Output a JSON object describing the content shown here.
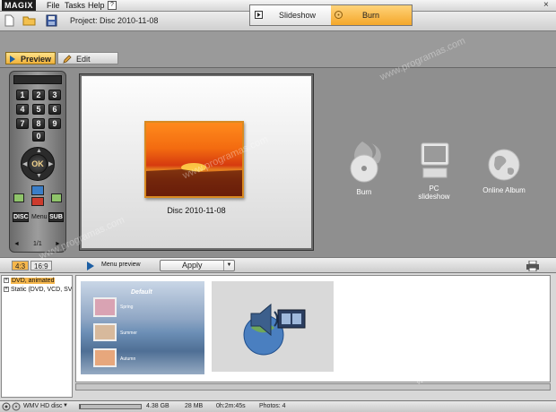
{
  "app": {
    "logo": "MAGIX",
    "menu": [
      "File",
      "Tasks",
      "Help"
    ],
    "close": "×"
  },
  "toolbar": {
    "project_label": "Project: Disc 2010-11-08"
  },
  "modes": {
    "slideshow": "Slideshow",
    "burn": "Burn"
  },
  "view_tabs": {
    "preview": "Preview",
    "edit": "Edit"
  },
  "remote": {
    "keys": [
      "1",
      "2",
      "3",
      "4",
      "5",
      "6",
      "7",
      "8",
      "9",
      "0"
    ],
    "ok": "OK",
    "disc": "DISC",
    "menu": "Menu",
    "sub": "SUB",
    "page": "1/1"
  },
  "preview": {
    "title": "Disc 2010-11-08"
  },
  "options": {
    "burn": "Burn",
    "pc_slideshow_line1": "PC",
    "pc_slideshow_line2": "slideshow",
    "online_album": "Online Album"
  },
  "lower_bar": {
    "ratio_43": "4:3",
    "ratio_169": "16:9",
    "menu_preview": "Menu preview",
    "apply": "Apply"
  },
  "tree": {
    "items": [
      "DVD, animated",
      "Static (DVD, VCD, SV"
    ]
  },
  "template1": {
    "title": "Default",
    "labels": [
      "Spring",
      "Summer",
      "Autumn"
    ]
  },
  "status": {
    "format": "WMV HD disc",
    "size": "4.38 GB",
    "used": "28 MB",
    "duration": "0h:2m:45s",
    "photos": "Photos: 4",
    "progress": 0.01
  },
  "colors": {
    "accent": "#f6b74d",
    "burn_tab": "#f4a72a"
  },
  "watermark": "www.programas.com"
}
